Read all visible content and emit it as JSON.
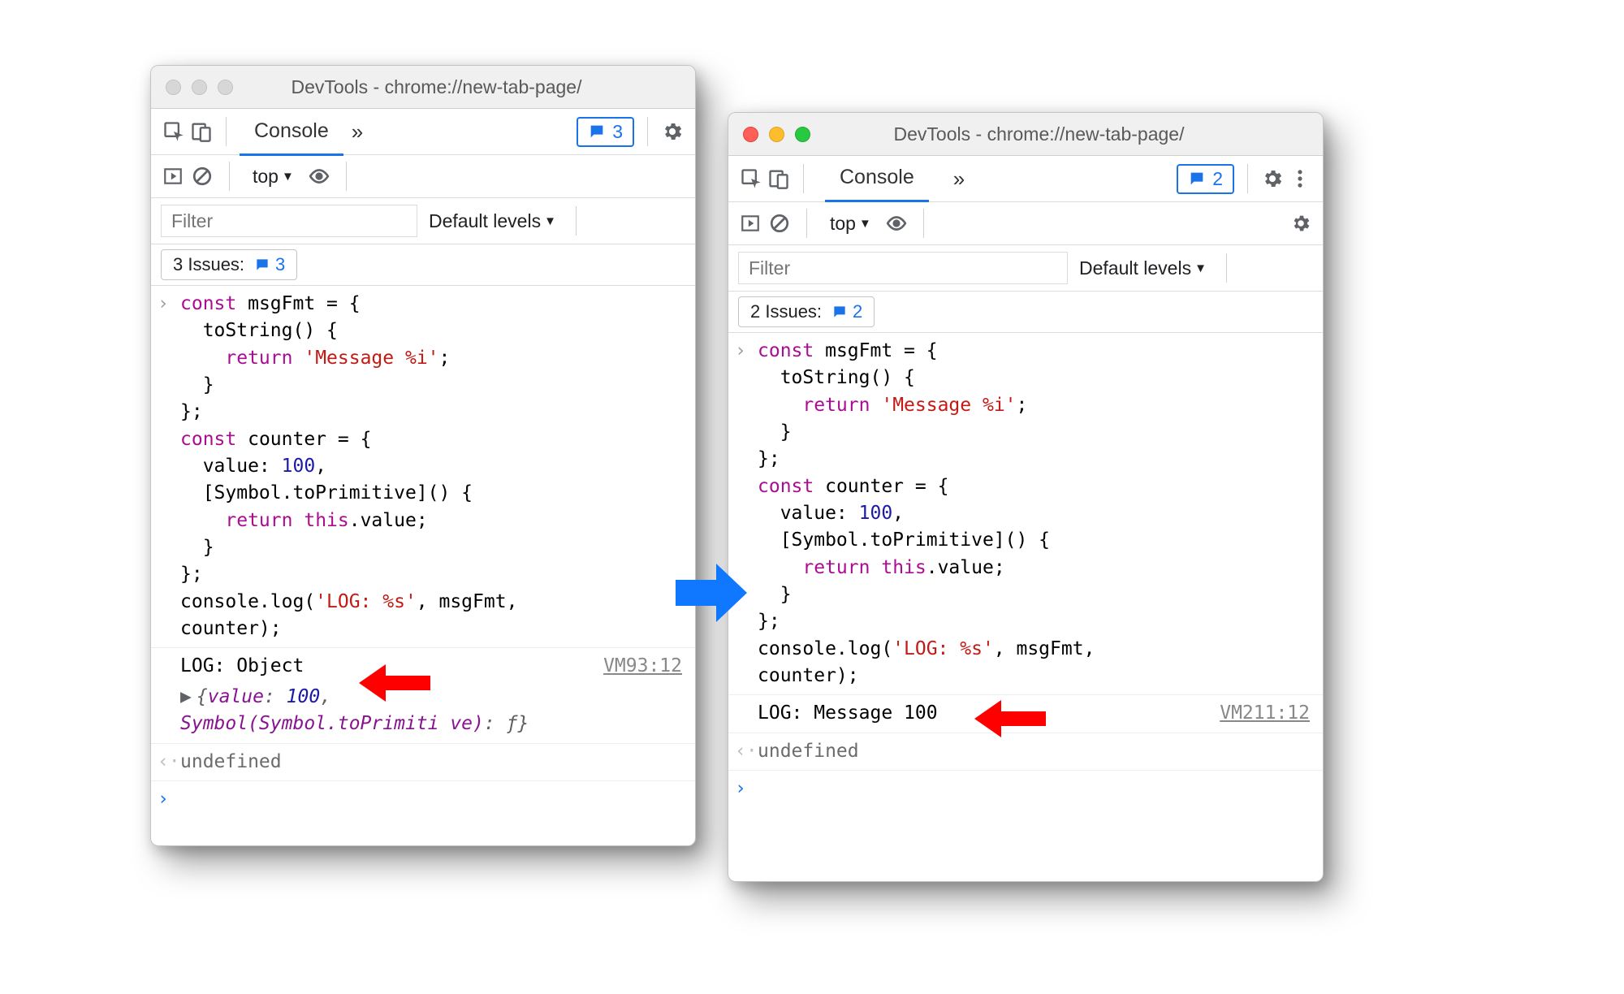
{
  "left": {
    "title": "DevTools - chrome://new-tab-page/",
    "tab": "Console",
    "badge_count": "3",
    "context": "top",
    "filter_placeholder": "Filter",
    "filter_width": 290,
    "levels": "Default levels",
    "issues_count_label": "3 Issues:",
    "issues_count_badge": "3",
    "code_html": "<span class=\"kw\">const</span> msgFmt = {\n  toString() {\n    <span class=\"kw\">return</span> <span class=\"str\">'Message %i'</span>;\n  }\n};\n<span class=\"kw\">const</span> counter = {\n  value: <span class=\"num\">100</span>,\n  [Symbol.toPrimitive]() {\n    <span class=\"kw\">return</span> <span class=\"kw\">this</span>.value;\n  }\n};\nconsole.log(<span class=\"str\">'LOG: %s'</span>, msgFmt,\ncounter);",
    "out_line1": "LOG: Object",
    "out_expand_html": "{<span class=\"k\">value</span>: <span class=\"n\">100</span>, <span class=\"k\">Symbol(Symbol.toPrimiti\nve)</span>: <span class=\"f\">ƒ</span>}",
    "out_src": "VM93:12",
    "return": "undefined"
  },
  "right": {
    "title": "DevTools - chrome://new-tab-page/",
    "tab": "Console",
    "badge_count": "2",
    "context": "top",
    "filter_placeholder": "Filter",
    "filter_width": 380,
    "levels": "Default levels",
    "issues_count_label": "2 Issues:",
    "issues_count_badge": "2",
    "code_html": "<span class=\"kw\">const</span> msgFmt = {\n  toString() {\n    <span class=\"kw\">return</span> <span class=\"str\">'Message %i'</span>;\n  }\n};\n<span class=\"kw\">const</span> counter = {\n  value: <span class=\"num\">100</span>,\n  [Symbol.toPrimitive]() {\n    <span class=\"kw\">return</span> <span class=\"kw\">this</span>.value;\n  }\n};\nconsole.log(<span class=\"str\">'LOG: %s'</span>, msgFmt,\ncounter);",
    "out_line1": "LOG: Message 100",
    "out_src": "VM211:12",
    "return": "undefined"
  }
}
